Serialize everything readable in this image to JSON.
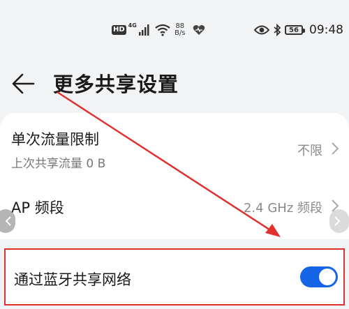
{
  "status_bar": {
    "hd_badge": "HD",
    "network_type": "4G",
    "net_speed_value": "88",
    "net_speed_unit": "B/s",
    "battery": "56",
    "time": "09:48"
  },
  "header": {
    "title": "更多共享设置"
  },
  "settings": [
    {
      "title": "单次流量限制",
      "subtitle": "上次共享流量 0 B",
      "value": "不限"
    },
    {
      "title": "AP 频段",
      "value": "2.4 GHz 频段"
    }
  ],
  "bluetooth_share": {
    "title": "通过蓝牙共享网络",
    "enabled": true
  },
  "colors": {
    "accent": "#1565e6",
    "annotation": "#e0312f",
    "background": "#f1f3f5"
  }
}
